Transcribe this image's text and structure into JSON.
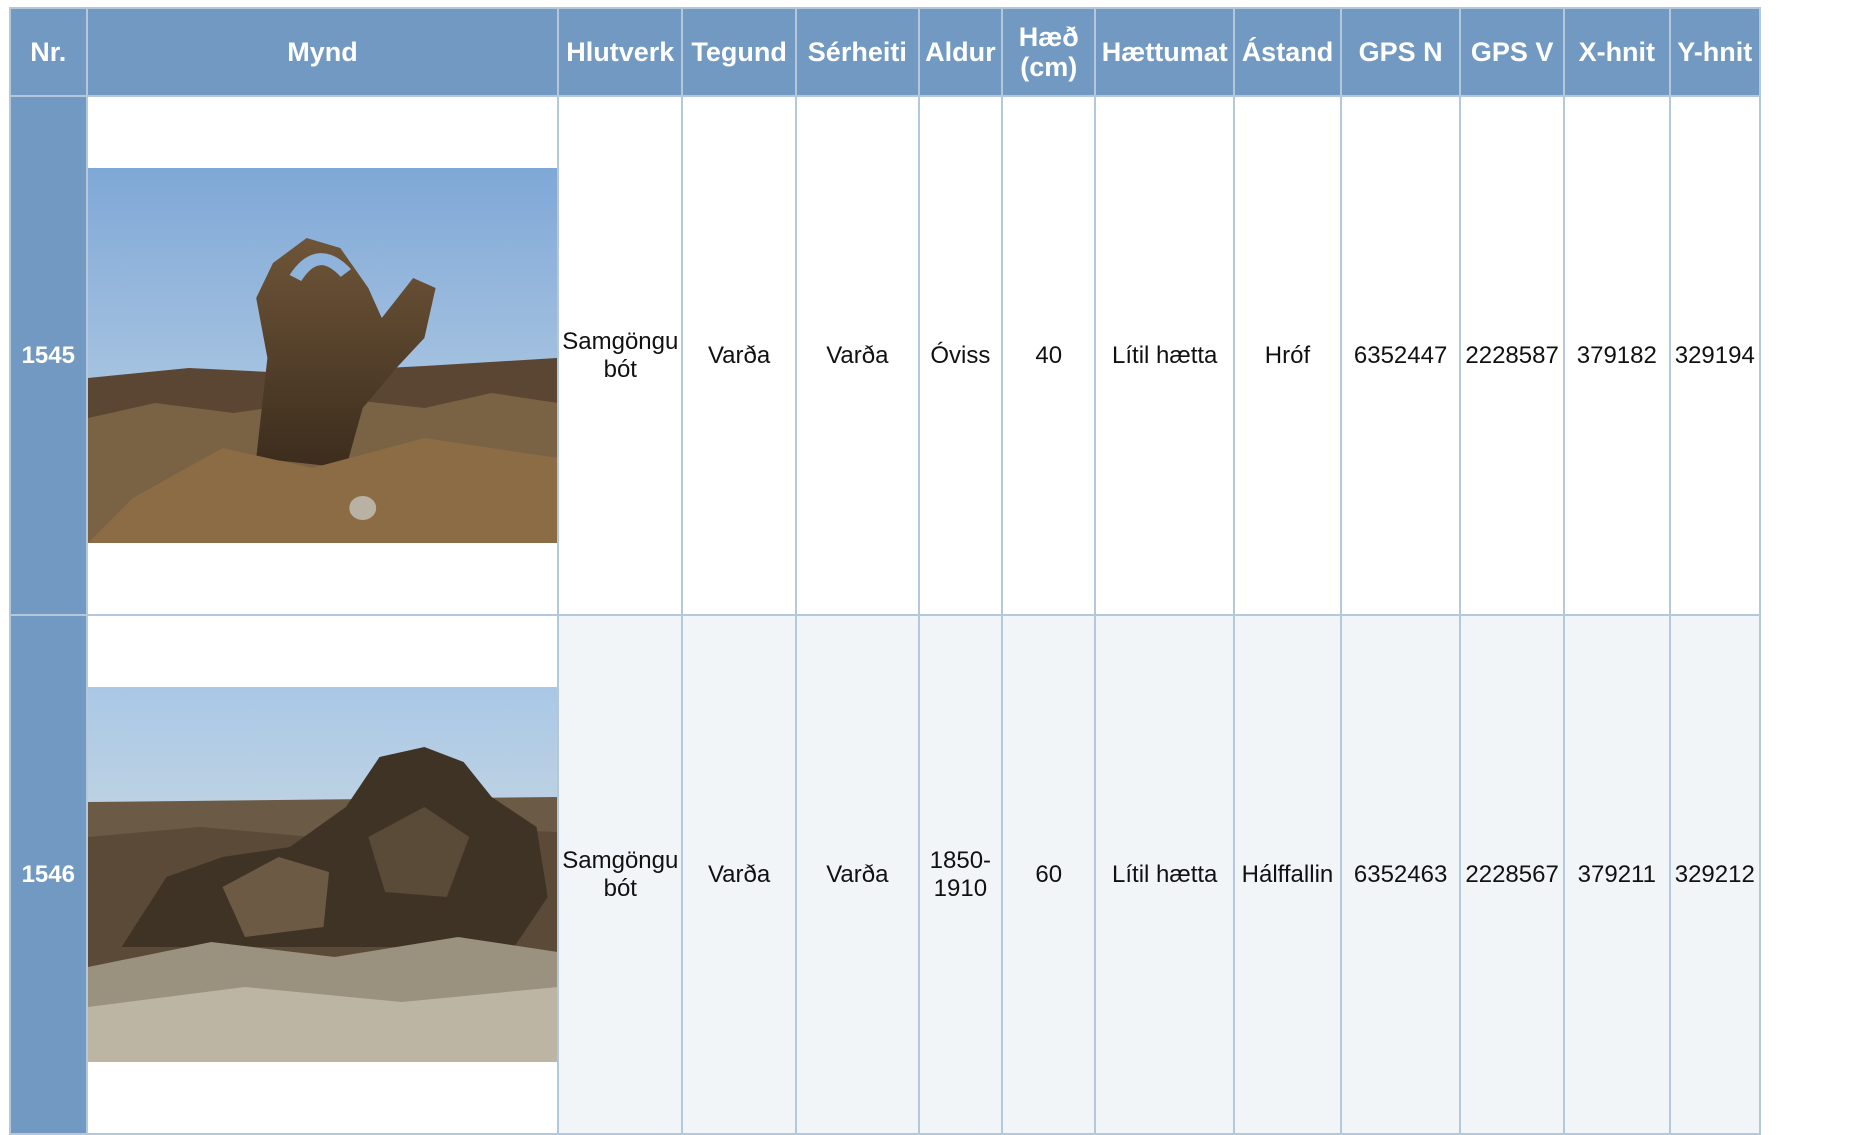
{
  "columns": {
    "nr": "Nr.",
    "mynd": "Mynd",
    "hlutverk": "Hlutverk",
    "tegund": "Tegund",
    "serheiti": "Sérheiti",
    "aldur": "Aldur",
    "haed_line1": "Hæð",
    "haed_line2": "(cm)",
    "haettumat": "Hættumat",
    "astand": "Ástand",
    "gps_n": "GPS N",
    "gps_v": "GPS V",
    "x_hnit": "X-hnit",
    "y_hnit": "Y-hnit"
  },
  "rows": [
    {
      "nr": "1545",
      "hlutverk_line1": "Samgöngu",
      "hlutverk_line2": "bót",
      "tegund": "Varða",
      "serheiti": "Varða",
      "aldur_line1": "Óviss",
      "aldur_line2": "",
      "haed": "40",
      "haettumat": "Lítil hætta",
      "astand": "Hróf",
      "gps_n": "6352447",
      "gps_v": "2228587",
      "x_hnit": "379182",
      "y_hnit": "329194"
    },
    {
      "nr": "1546",
      "hlutverk_line1": "Samgöngu",
      "hlutverk_line2": "bót",
      "tegund": "Varða",
      "serheiti": "Varða",
      "aldur_line1": "1850-",
      "aldur_line2": "1910",
      "haed": "60",
      "haettumat": "Lítil hætta",
      "astand": "Hálffallin",
      "gps_n": "6352463",
      "gps_v": "2228567",
      "x_hnit": "379211",
      "y_hnit": "329212"
    }
  ],
  "colors": {
    "header_bg": "#7299c1",
    "header_text": "#ffffff",
    "grid": "#b4c8dc",
    "alt_row_bg": "#f1f5f7"
  }
}
